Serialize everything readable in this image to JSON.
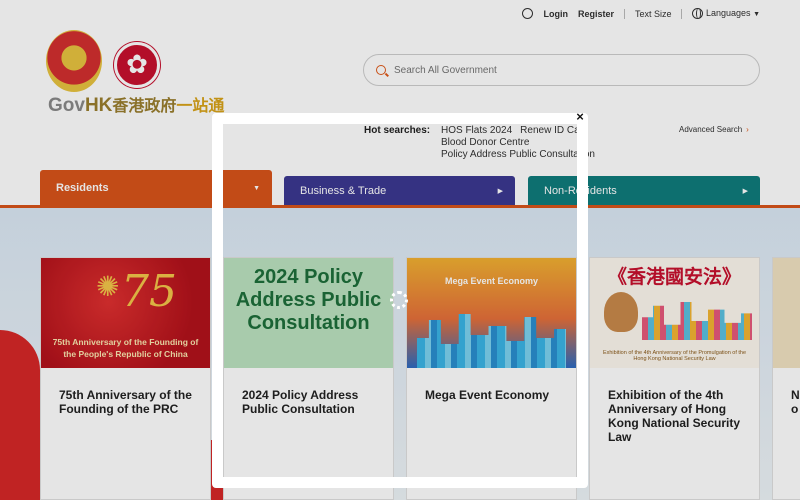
{
  "topbar": {
    "login": "Login",
    "register": "Register",
    "text_size": "Text Size",
    "languages": "Languages"
  },
  "logo": {
    "gov": "Gov",
    "hk": "HK",
    "zh_part1": "香港政府",
    "zh_part2": "一站通"
  },
  "search": {
    "placeholder": "Search All Government"
  },
  "hot_searches": {
    "label": "Hot searches:",
    "items": [
      "HOS Flats 2024",
      "Renew ID Card",
      "Blood Donor Centre",
      "Policy Address Public Consultation"
    ],
    "advanced": "Advanced Search"
  },
  "tabs": [
    {
      "label": "Residents",
      "active": true
    },
    {
      "label": "Business & Trade"
    },
    {
      "label": "Non-Residents"
    }
  ],
  "cards": [
    {
      "title": "75th Anniversary of the Founding of the PRC",
      "image_big": "75",
      "image_caption": "75th Anniversary of the Founding of the People's Republic of China"
    },
    {
      "title": "2024 Policy Address Public Consultation",
      "image_text": "2024 Policy Address Public Consultation"
    },
    {
      "title": "Mega Event Economy",
      "image_text": "Mega Event Economy"
    },
    {
      "title": "Exhibition of the 4th Anniversary of Hong Kong National Security Law",
      "image_text": "《香港國安法》",
      "image_caption": "Exhibition of the 4th Anniversary of the Promulgation of the Hong Kong National Security Law"
    },
    {
      "title": "N t o V"
    }
  ],
  "modal": {
    "close_label": "×"
  },
  "colors": {
    "residents": "#d9541a",
    "business": "#3c3891",
    "non_residents": "#0f7c7c"
  }
}
